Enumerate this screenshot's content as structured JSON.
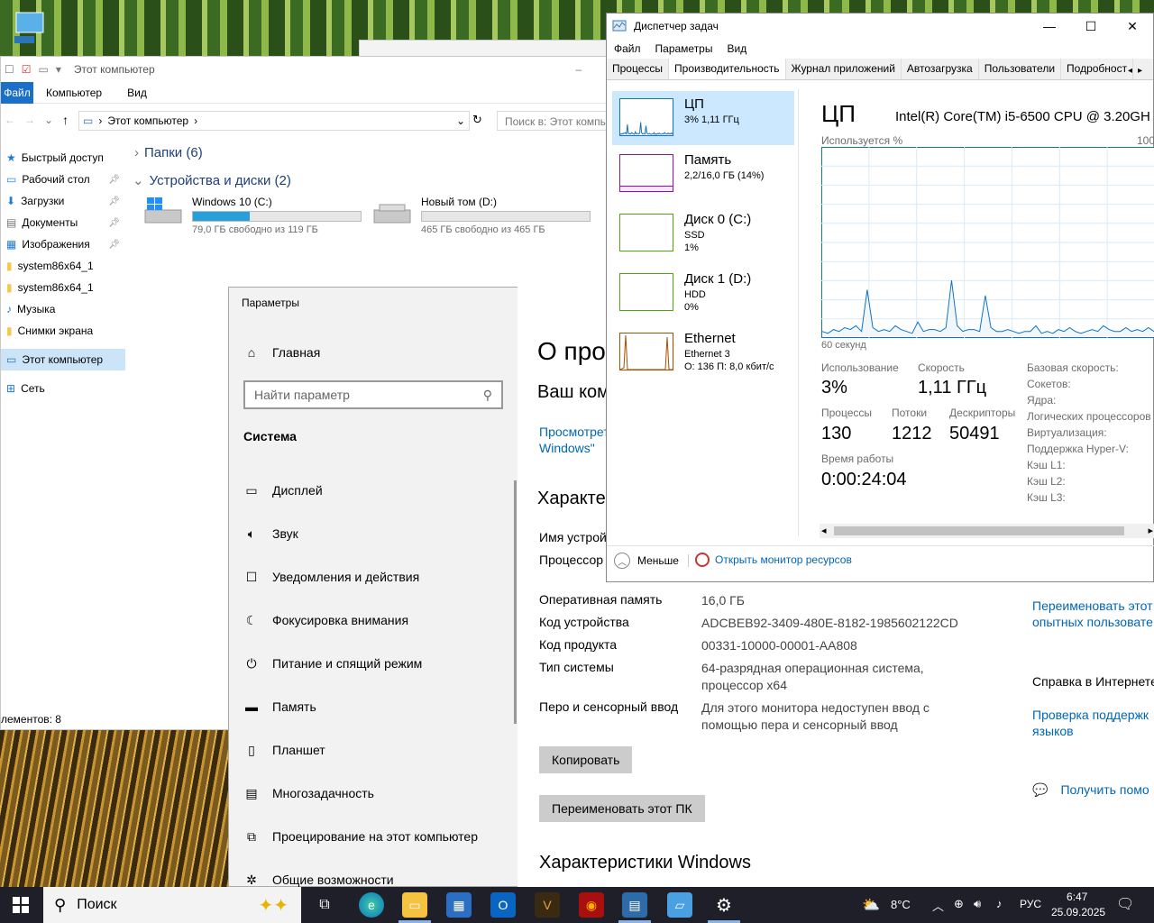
{
  "explorer": {
    "title": "Этот компьютер",
    "ribbon": {
      "file": "Файл",
      "computer": "Компьютер",
      "view": "Вид"
    },
    "address": "Этот компьютер",
    "search_placeholder": "Поиск в: Этот компь",
    "nav": [
      {
        "label": "Быстрый доступ",
        "icon": "star-icon",
        "pinned": false
      },
      {
        "label": "Рабочий стол",
        "icon": "desktop-icon",
        "pinned": true
      },
      {
        "label": "Загрузки",
        "icon": "download-icon",
        "pinned": true
      },
      {
        "label": "Документы",
        "icon": "documents-icon",
        "pinned": true
      },
      {
        "label": "Изображения",
        "icon": "pictures-icon",
        "pinned": true
      },
      {
        "label": "system86x64_1",
        "icon": "folder-icon",
        "pinned": false
      },
      {
        "label": "system86x64_1",
        "icon": "folder-icon",
        "pinned": false
      },
      {
        "label": "Музыка",
        "icon": "music-icon",
        "pinned": false
      },
      {
        "label": "Снимки экрана",
        "icon": "folder-icon",
        "pinned": false
      },
      {
        "label": "Этот компьютер",
        "icon": "computer-icon",
        "pinned": false
      },
      {
        "label": "Сеть",
        "icon": "network-icon",
        "pinned": false
      }
    ],
    "folders_header": "Папки (6)",
    "devices_header": "Устройства и диски (2)",
    "drives": [
      {
        "name": "Windows 10 (C:)",
        "free": "79,0 ГБ свободно из 119 ГБ",
        "used_fraction": 0.34
      },
      {
        "name": "Новый том (D:)",
        "free": "465 ГБ свободно из 465 ГБ",
        "used_fraction": 0.0
      }
    ],
    "status": "лементов: 8"
  },
  "settings": {
    "window_title": "Параметры",
    "home": "Главная",
    "search_placeholder": "Найти параметр",
    "section": "Система",
    "items": [
      {
        "label": "Дисплей",
        "icon": "display-icon"
      },
      {
        "label": "Звук",
        "icon": "sound-icon"
      },
      {
        "label": "Уведомления и действия",
        "icon": "notifications-icon"
      },
      {
        "label": "Фокусировка внимания",
        "icon": "moon-icon"
      },
      {
        "label": "Питание и спящий режим",
        "icon": "power-icon"
      },
      {
        "label": "Память",
        "icon": "storage-icon"
      },
      {
        "label": "Планшет",
        "icon": "tablet-icon"
      },
      {
        "label": "Многозадачность",
        "icon": "multitasking-icon"
      },
      {
        "label": "Проецирование на этот компьютер",
        "icon": "projecting-icon"
      },
      {
        "label": "Общие возможности",
        "icon": "shared-icon"
      }
    ],
    "main": {
      "heading": "О про",
      "subheading": "Ваш ком",
      "link1a": "Просмотрет",
      "link1b": "Windows\"",
      "specs_header": "Характер",
      "device_name_label": "Имя устрой",
      "processor_label": "Процессор",
      "rows": [
        {
          "k": "Оперативная память",
          "v": "16,0 ГБ"
        },
        {
          "k": "Код устройства",
          "v": "ADCBEB92-3409-480E-8182-1985602122CD"
        },
        {
          "k": "Код продукта",
          "v": "00331-10000-00001-AA808"
        },
        {
          "k": "Тип системы",
          "v": "64-разрядная операционная система, процессор x64"
        },
        {
          "k": "Перо и сенсорный ввод",
          "v": "Для этого монитора недоступен ввод с помощью пера и сенсорный ввод"
        }
      ],
      "copy_button": "Копировать",
      "rename_button": "Переименовать этот ПК",
      "windows_specs": "Характеристики Windows",
      "side_link1a": "Переименовать этот",
      "side_link1b": "опытных пользовате",
      "side_heading": "Справка в Интернете",
      "side_link2a": "Проверка поддержк",
      "side_link2b": "языков",
      "side_link3": "Получить помо"
    }
  },
  "taskmgr": {
    "title": "Диспетчер задач",
    "menu": [
      "Файл",
      "Параметры",
      "Вид"
    ],
    "tabs": [
      "Процессы",
      "Производительность",
      "Журнал приложений",
      "Автозагрузка",
      "Пользователи",
      "Подробност"
    ],
    "active_tab": 1,
    "resources": [
      {
        "name": "ЦП",
        "d1": "3% 1,11 ГГц",
        "d2": "",
        "color": "#1173c4"
      },
      {
        "name": "Память",
        "d1": "2,2/16,0 ГБ (14%)",
        "d2": "",
        "color": "#8b12ae"
      },
      {
        "name": "Диск 0 (C:)",
        "d1": "SSD",
        "d2": "1%",
        "color": "#4da60c"
      },
      {
        "name": "Диск 1 (D:)",
        "d1": "HDD",
        "d2": "0%",
        "color": "#4da60c"
      },
      {
        "name": "Ethernet",
        "d1": "Ethernet 3",
        "d2": "О: 136 П: 8,0 кбит/с",
        "color": "#a74f01"
      }
    ],
    "cpu": {
      "title": "ЦП",
      "model": "Intel(R) Core(TM) i5-6500 CPU @ 3.20GH",
      "usage_label": "Используется %",
      "max_label": "100%",
      "time_label": "60 секунд",
      "usage_series": [
        3,
        2,
        4,
        3,
        5,
        4,
        6,
        3,
        25,
        5,
        3,
        4,
        3,
        6,
        4,
        3,
        2,
        8,
        3,
        4,
        4,
        3,
        5,
        30,
        6,
        3,
        4,
        4,
        3,
        22,
        5,
        3,
        3,
        4,
        3,
        2,
        3,
        3,
        6,
        2,
        3,
        2,
        4,
        3,
        5,
        3,
        2,
        3,
        4,
        3,
        6,
        4,
        3,
        3,
        5,
        3,
        4,
        3,
        5,
        3
      ],
      "stats": [
        {
          "label": "Использование",
          "value": "3%"
        },
        {
          "label": "Скорость",
          "value": "1,11 ГГц"
        },
        {
          "label": "Процессы",
          "value": "130"
        },
        {
          "label": "Потоки",
          "value": "1212"
        },
        {
          "label": "Дескрипторы",
          "value": "50491"
        },
        {
          "label": "Время работы",
          "value": "0:00:24:04"
        }
      ],
      "right": [
        "Базовая скорость:",
        "Сокетов:",
        "Ядра:",
        "Логических процессоров",
        "Виртуализация:",
        "Поддержка Hyper-V:",
        "Кэш L1:",
        "Кэш L2:",
        "Кэш L3:"
      ]
    },
    "less": "Меньше",
    "monitor_link": "Открыть монитор ресурсов"
  },
  "taskbar": {
    "search": "Поиск",
    "weather": "8°C",
    "lang": "РУС",
    "time": "6:47",
    "date": "25.09.2025"
  }
}
